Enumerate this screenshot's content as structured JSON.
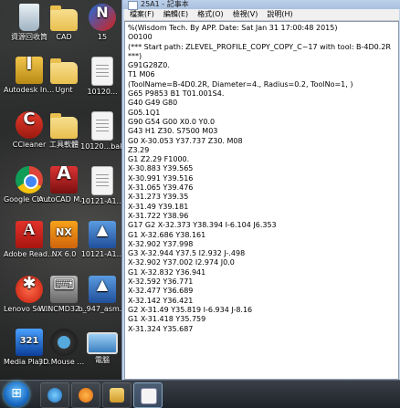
{
  "window": {
    "title": "25A1 - 記事本",
    "menu": [
      "檔案(F)",
      "編輯(E)",
      "格式(O)",
      "檢視(V)",
      "說明(H)"
    ]
  },
  "notepad_lines": [
    "%(Wisdom Tech. By APP. Date: Sat Jan 31 17:00:48 2015)",
    "O0100",
    "(*** Start path: ZLEVEL_PROFILE_COPY_COPY_C~17 with tool: B-4D0.2R ***)",
    "G91G28Z0.",
    "T1 M06",
    "(ToolName=B-4D0.2R, Diameter=4., Radius=0.2, ToolNo=1, )",
    "G65 P9853 B1 T01.001S4.",
    "G40 G49 G80",
    "G05.1Q1",
    "G90 G54 G00 X0.0 Y0.0",
    "G43 H1 Z30. S7500 M03",
    "G0 X-30.053 Y37.737 Z30. M08",
    "Z3.29",
    "G1 Z2.29 F1000.",
    "X-30.883 Y39.565",
    "X-30.991 Y39.516",
    "X-31.065 Y39.476",
    "X-31.273 Y39.35",
    "X-31.49 Y39.181",
    "X-31.722 Y38.96",
    "G17 G2 X-32.373 Y38.394 I-6.104 J6.353",
    "G1 X-32.686 Y38.161",
    "X-32.902 Y37.998",
    "G3 X-32.944 Y37.5 I2.932 J-.498",
    "X-32.902 Y37.002 I2.974 J0.0",
    "G1 X-32.832 Y36.941",
    "X-32.592 Y36.771",
    "X-32.477 Y36.689",
    "X-32.142 Y36.421",
    "G2 X-31.49 Y35.819 I-6.934 J-8.16",
    "G1 X-31.418 Y35.759",
    "X-31.324 Y35.687"
  ],
  "desktop_icons": [
    {
      "name": "資源回收筒",
      "kind": "recycle"
    },
    {
      "name": "CAD",
      "kind": "folder"
    },
    {
      "name": "15",
      "kind": "app15"
    },
    {
      "name": "Autodesk Inventor 2009",
      "kind": "inventor"
    },
    {
      "name": "Ugnt",
      "kind": "folder"
    },
    {
      "name": "10120...",
      "kind": "doc"
    },
    {
      "name": "CCleaner",
      "kind": "ccleaner"
    },
    {
      "name": "工具軟體",
      "kind": "folder"
    },
    {
      "name": "10120...bak",
      "kind": "doc"
    },
    {
      "name": "Google Chrome",
      "kind": "chrome"
    },
    {
      "name": "AutoCAD Mechanic...",
      "kind": "autocad"
    },
    {
      "name": "10121-A1...",
      "kind": "doc"
    },
    {
      "name": "Adobe Reader 9",
      "kind": "pdf"
    },
    {
      "name": "NX 6.0",
      "kind": "nx"
    },
    {
      "name": "10121-A1...",
      "kind": "cad"
    },
    {
      "name": "Lenovo Soluti...",
      "kind": "lenovo"
    },
    {
      "name": "WINCMD32 - 捷徑",
      "kind": "wincmd"
    },
    {
      "name": "b_947_asm...",
      "kind": "cad"
    },
    {
      "name": "Media Player Classic",
      "kind": "mediaplayer"
    },
    {
      "name": "3D Mouse Home",
      "kind": "mouse3d"
    },
    {
      "name": "電腦",
      "kind": "computer"
    }
  ],
  "taskbar": {
    "items": [
      "ie",
      "media",
      "explorer",
      "notepad"
    ]
  }
}
